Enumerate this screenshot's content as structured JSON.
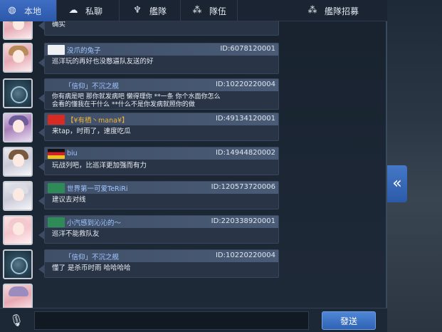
{
  "tabs": [
    {
      "label": "本地",
      "icon": "globe-icon"
    },
    {
      "label": "私聊",
      "icon": "chat-bubble-icon"
    },
    {
      "label": "艦隊",
      "icon": "fleet-emblem-icon"
    },
    {
      "label": "隊伍",
      "icon": "team-icon"
    },
    {
      "label": "艦隊招募",
      "icon": "recruit-icon"
    }
  ],
  "messages": [
    {
      "name": "",
      "uid": "",
      "text": "确实",
      "avatar": "anime"
    },
    {
      "name": "没爪的兔子",
      "uid": "ID:6078120001",
      "text": "巡洋玩的再好也没憨逼队友送的好",
      "avatar": "anime",
      "flag": "white"
    },
    {
      "name": "「信仰」不沉之舰",
      "uid": "ID:10220220004",
      "text": "你有病是吧 那你就发病吧 懒得理你 **一条 你个水面你怎么\n会看的懂我在干什么 **什么不是你发病就照你的做",
      "avatar": "ship",
      "flag": "none"
    },
    {
      "name": "【¥有栖丶mana¥】",
      "uid": "ID:49134120001",
      "text": "来tap，时雨了，速度吃瓜",
      "avatar": "anime2",
      "flag": "china"
    },
    {
      "name": "biu",
      "uid": "ID:14944820002",
      "text": "玩战列吧，比巡洋更加强而有力",
      "avatar": "anime3",
      "flag": "germany"
    },
    {
      "name": "世界第一可爱TeRiRi",
      "uid": "ID:120573720006",
      "text": "建议去对线",
      "avatar": "anime3",
      "flag": "green"
    },
    {
      "name": "小汽感到沁沁的〜",
      "uid": "ID:220338920001",
      "text": "巡洋不能救队友",
      "avatar": "anime4",
      "flag": "green"
    },
    {
      "name": "「信仰」不沉之舰",
      "uid": "ID:10220220004",
      "text": "懂了 是杀币时雨 哈哈哈哈",
      "avatar": "ship",
      "flag": "none"
    }
  ],
  "bottom": {
    "send_label": "發送",
    "mic_icon": "microphone-icon"
  },
  "colors": {
    "accent": "#3f6ec4",
    "name_blue": "#9fc7ff",
    "name_gold": "#f0b23a"
  }
}
